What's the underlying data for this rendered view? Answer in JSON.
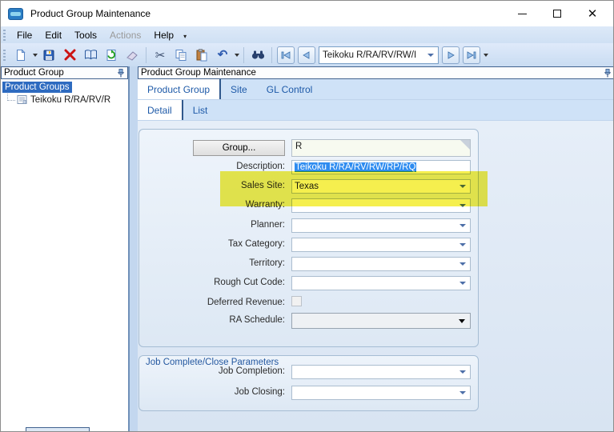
{
  "window": {
    "title": "Product Group Maintenance",
    "controls": {
      "minimize": "minimize",
      "maximize": "maximize",
      "close": "close"
    }
  },
  "menu": {
    "items": [
      {
        "label": "File",
        "enabled": true
      },
      {
        "label": "Edit",
        "enabled": true
      },
      {
        "label": "Tools",
        "enabled": true
      },
      {
        "label": "Actions",
        "enabled": false
      },
      {
        "label": "Help",
        "enabled": true
      }
    ]
  },
  "toolbar": {
    "icons": [
      "new-document",
      "save",
      "delete",
      "book-view",
      "refresh",
      "clear",
      "cut",
      "copy",
      "paste",
      "undo",
      "find",
      "nav-first",
      "nav-previous",
      "nav-next",
      "nav-last"
    ],
    "record_selector_value": "Teikoku R/RA/RV/RW/I"
  },
  "left_panel": {
    "header": "Product Group",
    "tree": {
      "root": "Product Groups",
      "child": "Teikoku R/RA/RV/R"
    }
  },
  "main_panel": {
    "header": "Product Group Maintenance",
    "tabs": [
      {
        "label": "Product Group",
        "active": true
      },
      {
        "label": "Site",
        "active": false
      },
      {
        "label": "GL Control",
        "active": false
      }
    ],
    "subtabs": [
      {
        "label": "Detail",
        "active": true
      },
      {
        "label": "List",
        "active": false
      }
    ]
  },
  "form": {
    "group_button_label": "Group...",
    "group_value": "R",
    "fields": [
      {
        "label": "Description:",
        "value": "Teikoku R/RA/RV/RW/RP/RQ",
        "type": "text-selected"
      },
      {
        "label": "Sales Site:",
        "value": "Texas",
        "type": "combo",
        "highlighted": true
      },
      {
        "label": "Warranty:",
        "value": "",
        "type": "combo",
        "highlighted": true
      },
      {
        "label": "Planner:",
        "value": "",
        "type": "combo"
      },
      {
        "label": "Tax Category:",
        "value": "",
        "type": "combo"
      },
      {
        "label": "Territory:",
        "value": "",
        "type": "combo"
      },
      {
        "label": "Rough Cut Code:",
        "value": "",
        "type": "combo"
      },
      {
        "label": "Deferred Revenue:",
        "value": false,
        "type": "checkbox"
      },
      {
        "label": "RA Schedule:",
        "value": "",
        "type": "combo-flat"
      }
    ],
    "job_section": {
      "title": "Job Complete/Close Parameters",
      "fields": [
        {
          "label": "Job Completion:",
          "value": "",
          "type": "combo"
        },
        {
          "label": "Job Closing:",
          "value": "",
          "type": "combo"
        }
      ]
    }
  },
  "colors": {
    "highlight_marker": "#f5ee3f",
    "selection_blue": "#2e8cf0",
    "tree_selection": "#2e6bc0",
    "tab_text": "#1e5aa8",
    "toolbar_bg": "#cfe0f4",
    "content_bg": "#dde8f4"
  }
}
